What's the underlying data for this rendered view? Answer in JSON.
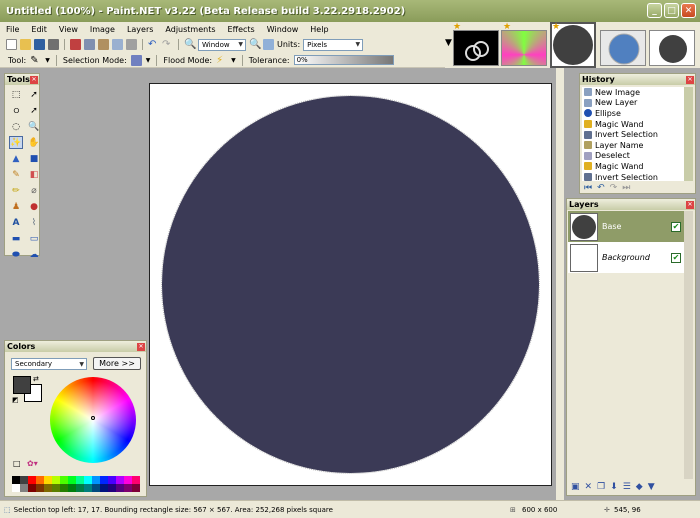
{
  "window": {
    "title": "Untitled (100%) - Paint.NET v3.22 (Beta Release build 3.22.2918.2902)"
  },
  "menu": {
    "items": [
      "File",
      "Edit",
      "View",
      "Image",
      "Layers",
      "Adjustments",
      "Effects",
      "Window",
      "Help"
    ]
  },
  "toolbar": {
    "zoom_combo": "Window",
    "units_label": "Units:",
    "units_value": "Pixels",
    "tool_label": "Tool:",
    "selection_mode_label": "Selection Mode:",
    "flood_mode_label": "Flood Mode:",
    "tolerance_label": "Tolerance:",
    "tolerance_value": "0%"
  },
  "tools_panel": {
    "title": "Tools",
    "tools": [
      "rectangle-select",
      "move-selection",
      "lasso-select",
      "move-selected",
      "ellipse-select",
      "zoom",
      "magic-wand",
      "pan",
      "paint-bucket",
      "gradient",
      "paintbrush",
      "eraser",
      "pencil",
      "color-picker",
      "clone-stamp",
      "recolor",
      "text",
      "line-curve",
      "rectangle",
      "rounded-rectangle",
      "ellipse",
      "freeform-shape"
    ],
    "selected_index": 6
  },
  "history_panel": {
    "title": "History",
    "items": [
      "New Image",
      "New Layer",
      "Ellipse",
      "Magic Wand",
      "Invert Selection",
      "Layer Name",
      "Deselect",
      "Magic Wand",
      "Invert Selection"
    ]
  },
  "layers_panel": {
    "title": "Layers",
    "layers": [
      {
        "name": "Base",
        "visible": true,
        "selected": true
      },
      {
        "name": "Background",
        "visible": true,
        "selected": false
      }
    ]
  },
  "colors_panel": {
    "title": "Colors",
    "mode": "Secondary",
    "more_button": "More >>",
    "primary_color": "#404040",
    "secondary_color": "#ffffff"
  },
  "canvas": {
    "shape_color": "#3b3a56"
  },
  "status": {
    "selection_text": "Selection top left: 17, 17. Bounding rectangle size: 567 × 567. Area: 252,268 pixels square",
    "image_size": "600 x 600",
    "cursor_pos": "545, 96"
  }
}
